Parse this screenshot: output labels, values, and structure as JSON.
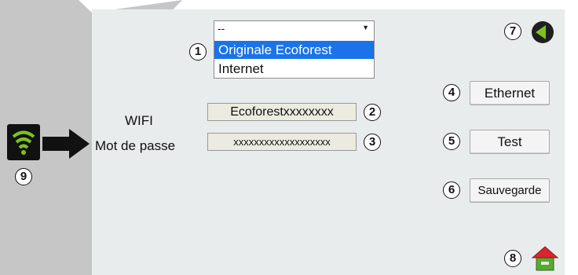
{
  "wifi_select": {
    "selected": "--",
    "options": [
      "Originale Ecoforest",
      "Internet"
    ]
  },
  "form": {
    "wifi_label": "WIFI",
    "wifi_value": "Ecoforestxxxxxxxx",
    "password_label": "Mot de passe",
    "password_value": "xxxxxxxxxxxxxxxxxxx"
  },
  "buttons": {
    "ethernet": "Ethernet",
    "test": "Test",
    "save": "Sauvegarde"
  },
  "callouts": {
    "n1": "1",
    "n2": "2",
    "n3": "3",
    "n4": "4",
    "n5": "5",
    "n6": "6",
    "n7": "7",
    "n8": "8",
    "n9": "9"
  },
  "icons": {
    "back": "back-arrow-icon",
    "home": "home-icon",
    "wifi": "wifi-icon",
    "pointer": "right-arrow-icon"
  },
  "colors": {
    "panel": "#e9ecec",
    "side_dark": "#c6c6c6",
    "highlight": "#1a73e8",
    "wifi_green": "#7ec21e",
    "home_green": "#5aa832",
    "home_roof": "#d8262c"
  }
}
